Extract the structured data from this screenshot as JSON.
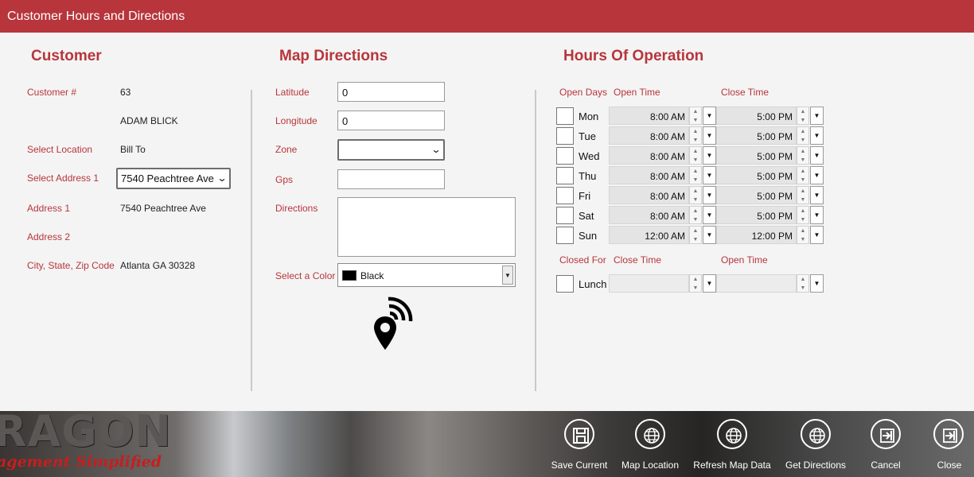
{
  "window": {
    "title": "Customer Hours and Directions"
  },
  "customer": {
    "heading": "Customer",
    "customer_no_label": "Customer #",
    "customer_no": "63",
    "name": "ADAM BLICK",
    "location_label": "Select Location",
    "location": "Bill To",
    "address_select_label": "Select Address 1",
    "address_select": "7540 Peachtree Ave",
    "address1_label": "Address 1",
    "address1": "7540 Peachtree Ave",
    "address2_label": "Address 2",
    "address2": "",
    "city_label": "City, State, Zip Code",
    "city": "Atlanta GA 30328"
  },
  "map": {
    "heading": "Map Directions",
    "latitude_label": "Latitude",
    "latitude": "0",
    "longitude_label": "Longitude",
    "longitude": "0",
    "zone_label": "Zone",
    "zone": "",
    "gps_label": "Gps",
    "gps": "",
    "directions_label": "Directions",
    "directions": "",
    "color_label": "Select a Color",
    "color": "Black",
    "color_swatch": "#000000",
    "pin_icon": "location-signal-icon"
  },
  "hours": {
    "heading": "Hours Of Operation",
    "col_days": "Open Days",
    "col_open": "Open Time",
    "col_close": "Close Time",
    "days": [
      {
        "name": "Mon",
        "open": "8:00 AM",
        "close": "5:00 PM"
      },
      {
        "name": "Tue",
        "open": "8:00 AM",
        "close": "5:00 PM"
      },
      {
        "name": "Wed",
        "open": "8:00 AM",
        "close": "5:00 PM"
      },
      {
        "name": "Thu",
        "open": "8:00 AM",
        "close": "5:00 PM"
      },
      {
        "name": "Fri",
        "open": "8:00 AM",
        "close": "5:00 PM"
      },
      {
        "name": "Sat",
        "open": "8:00 AM",
        "close": "5:00 PM"
      },
      {
        "name": "Sun",
        "open": "12:00 AM",
        "close": "12:00 PM"
      }
    ],
    "closed_for_label": "Closed For",
    "closed_close_label": "Close Time",
    "closed_open_label": "Open Time",
    "lunch": {
      "name": "Lunch",
      "close": "",
      "open": ""
    }
  },
  "footer": {
    "brand": "RAGON",
    "tagline": "agement Simplified",
    "buttons": [
      {
        "label": "Save Current",
        "icon": "save-icon"
      },
      {
        "label": "Map Location",
        "icon": "globe-icon"
      },
      {
        "label": "Refresh Map Data",
        "icon": "globe-icon"
      },
      {
        "label": "Get Directions",
        "icon": "globe-icon"
      },
      {
        "label": "Cancel",
        "icon": "exit-icon"
      },
      {
        "label": "Close",
        "icon": "exit-icon"
      }
    ]
  },
  "colors": {
    "accent": "#b8353b",
    "title_text": "#ffffff",
    "background": "#f4f4f4"
  }
}
